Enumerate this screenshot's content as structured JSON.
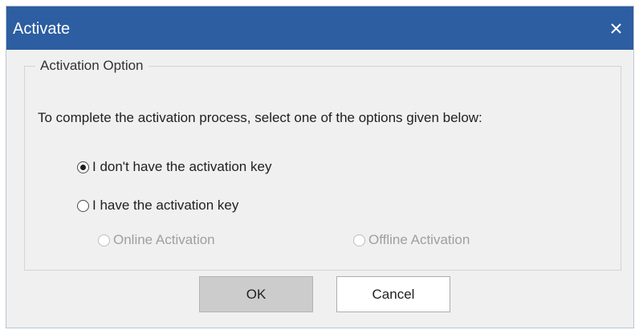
{
  "window": {
    "title": "Activate",
    "close_icon": "close-icon",
    "titlebar_color": "#2c5ea1"
  },
  "group": {
    "legend": "Activation Option",
    "instruction": "To complete the activation process, select one of the options given below:"
  },
  "options": [
    {
      "label": "I don't have the activation key",
      "selected": true,
      "enabled": true
    },
    {
      "label": "I have the activation key",
      "selected": false,
      "enabled": true
    }
  ],
  "sub_options": [
    {
      "label": "Online Activation",
      "selected": false,
      "enabled": false
    },
    {
      "label": "Offline Activation",
      "selected": false,
      "enabled": false
    }
  ],
  "buttons": {
    "ok": "OK",
    "cancel": "Cancel"
  }
}
